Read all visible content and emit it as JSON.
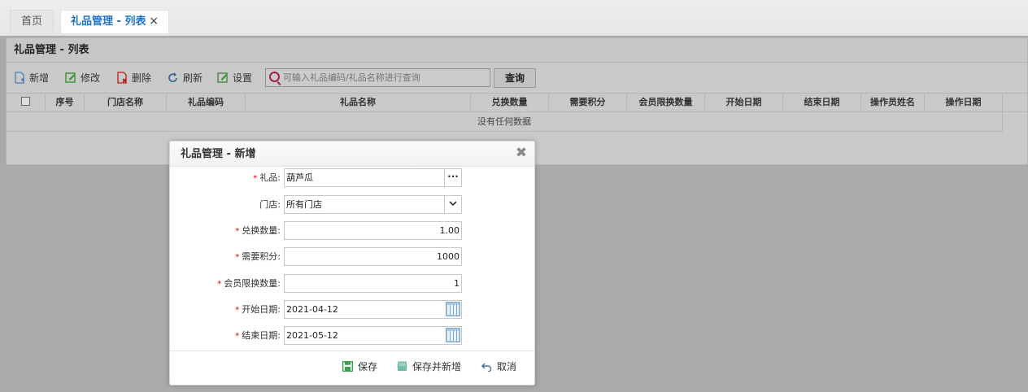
{
  "tabs": [
    {
      "label": "首页"
    },
    {
      "label": "礼品管理 - 列表",
      "close": "×"
    }
  ],
  "panel": {
    "title": "礼品管理 - 列表"
  },
  "toolbar": {
    "add": "新增",
    "edit": "修改",
    "delete": "删除",
    "refresh": "刷新",
    "settings": "设置",
    "search_placeholder": "可输入礼品编码/礼品名称进行查询",
    "query": "查询"
  },
  "grid": {
    "columns": [
      "序号",
      "门店名称",
      "礼品编码",
      "礼品名称",
      "兑换数量",
      "需要积分",
      "会员限换数量",
      "开始日期",
      "结束日期",
      "操作员姓名",
      "操作日期"
    ],
    "empty_text": "没有任何数据"
  },
  "dialog": {
    "title": "礼品管理 - 新增",
    "close": "✖",
    "fields": {
      "gift": {
        "label": "礼品:",
        "value": "葫芦瓜",
        "button": "···"
      },
      "store": {
        "label": "门店:",
        "value": "所有门店"
      },
      "qty": {
        "label": "兑换数量:",
        "value": "1.00"
      },
      "points": {
        "label": "需要积分:",
        "value": "1000"
      },
      "limit": {
        "label": "会员限换数量:",
        "value": "1"
      },
      "start": {
        "label": "开始日期:",
        "value": "2021-04-12"
      },
      "end": {
        "label": "结束日期:",
        "value": "2021-05-12"
      }
    },
    "required_mark": "*",
    "buttons": {
      "save": "保存",
      "save_new": "保存并新增",
      "cancel": "取消"
    }
  },
  "colors": {
    "accent": "#1f73c8",
    "required": "#dd0000",
    "save_icon": "#3aa24a"
  }
}
